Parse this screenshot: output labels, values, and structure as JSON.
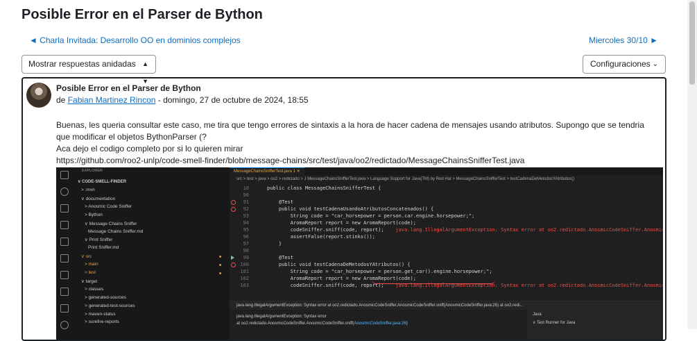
{
  "page": {
    "title": "Posible Error en el Parser de Bython",
    "prev_link": "◄ Charla Invitada: Desarrollo OO en dominios complejos",
    "next_link": "Miercoles 30/10 ►",
    "display_select": "Mostrar respuestas anidadas",
    "config_button": "Configuraciones"
  },
  "post": {
    "title": "Posible Error en el Parser de Bython",
    "by": "de ",
    "author": "Fabian Martinez Rincon",
    "date": " - domingo, 27 de octubre de 2024, 18:55",
    "paragraph1": "Buenas, les queria consultar este caso, me tira que tengo errores de sintaxis a la hora de hacer cadena de mensajes usando atributos. Supongo que se tendria que modificar el objetos BythonParser (?",
    "paragraph2": "Aca dejo el codigo completo por si lo quieren mirar",
    "link": "https://github.com/roo2-unlp/code-smell-finder/blob/message-chains/src/test/java/oo2/redictado/MessageChainsSnifferTest.java"
  },
  "vscode": {
    "explorer_header": "EXPLORER",
    "root": "∨ CODE-SMELL-FINDER",
    "tree": [
      {
        "label": "> .mvn",
        "indent": 1,
        "orange": false
      },
      {
        "label": "∨ documentation",
        "indent": 1,
        "orange": false
      },
      {
        "label": "> Anosmic Code Sniffer",
        "indent": 2,
        "orange": false
      },
      {
        "label": "> Bython",
        "indent": 2,
        "orange": false
      },
      {
        "label": "∨ Message Chains Sniffer",
        "indent": 2,
        "orange": false
      },
      {
        "label": "Message Chains Sniffer.md",
        "indent": 3,
        "orange": false
      },
      {
        "label": "∨ Print Sniffer",
        "indent": 2,
        "orange": false
      },
      {
        "label": "Print Sniffer.md",
        "indent": 3,
        "orange": false
      },
      {
        "label": "∨ src",
        "indent": 1,
        "orange": true
      },
      {
        "label": "> main",
        "indent": 2,
        "orange": true
      },
      {
        "label": "> test",
        "indent": 2,
        "orange": true
      },
      {
        "label": "∨ target",
        "indent": 1,
        "orange": false
      },
      {
        "label": "> classes",
        "indent": 2,
        "orange": false
      },
      {
        "label": "> generated-sources",
        "indent": 2,
        "orange": false
      },
      {
        "label": "> generated-test-sources",
        "indent": 2,
        "orange": false
      },
      {
        "label": "> maven-status",
        "indent": 2,
        "orange": false
      },
      {
        "label": "> surefire-reports",
        "indent": 2,
        "orange": false
      }
    ],
    "tab": "MessageChainsSnifferTest.java 1 ✕",
    "breadcrumbs": "src > test > java > oo2 > redictado > J MessageChainsSnifferTest.java > Language Support for Java(TM) by Red Hat > MessageChainsSnifferTest > testCadenaDeMetodosYAtributos()",
    "code": [
      {
        "n": "10",
        "text": "public class MessageChainsSnifferTest {",
        "mark": "",
        "err": ""
      },
      {
        "n": "90",
        "text": "",
        "mark": "",
        "err": ""
      },
      {
        "n": "91",
        "text": "    @Test",
        "mark": "err",
        "err": ""
      },
      {
        "n": "92",
        "text": "    public void testCadenaUsandoAtributosConcatenados() {",
        "mark": "err",
        "err": ""
      },
      {
        "n": "93",
        "text": "        String code = \"car_horsepower = person.car.engine.horsepower;\";",
        "mark": "",
        "err": ""
      },
      {
        "n": "94",
        "text": "        AromaReport report = new AromaReport(code);",
        "mark": "",
        "err": ""
      },
      {
        "n": "95",
        "text": "        codeSniffer.sniff(code, report);",
        "mark": "",
        "err": "    java.lang.IllegalArgumentException: Syntax error at oo2.redictado.AnosmicCodeSniffer.AnosmicCo"
      },
      {
        "n": "96",
        "text": "        assertFalse(report.stinks());",
        "mark": "",
        "err": ""
      },
      {
        "n": "97",
        "text": "    }",
        "mark": "",
        "err": ""
      },
      {
        "n": "98",
        "text": "",
        "mark": "",
        "err": ""
      },
      {
        "n": "99",
        "text": "    @Test",
        "mark": "run",
        "err": ""
      },
      {
        "n": "100",
        "text": "    public void testCadenaDeMetodosYAtributos() {",
        "mark": "err",
        "err": ""
      },
      {
        "n": "101",
        "text": "        String code = \"car_horsepower = person.get_car().engine.horsepower;\";",
        "mark": "",
        "err": ""
      },
      {
        "n": "102",
        "text": "        AromaReport report = new AromaReport(code);",
        "mark": "",
        "err": ""
      },
      {
        "n": "103",
        "text": "        codeSniffer.sniff(code, report);",
        "mark": "",
        "err": "    java.lang.IllegalArgumentException: Syntax error at oo2.redictado.AnosmicCodeSniffer.AnosmicCo"
      }
    ],
    "panel_header": "java.lang.IllegalArgumentException: Syntax error at oo2.redictado.AnosmicCodeSniffer.AnosmicCodeSniffer.sniff(AnosmicCodeSniffer.java:26) at oo2.redi...",
    "panel_line1": "java.lang.IllegalArgumentException: Syntax error",
    "panel_line2_pre": "at oo2.redictado.AnosmicCodeSniffer.AnosmicCodeSniffer.sniff(",
    "panel_line2_link": "AnosmicCodeSniffer.java:26",
    "panel_line2_post": ")",
    "side_java": "Java",
    "side_runner": "∨ Test Runner for Java"
  }
}
